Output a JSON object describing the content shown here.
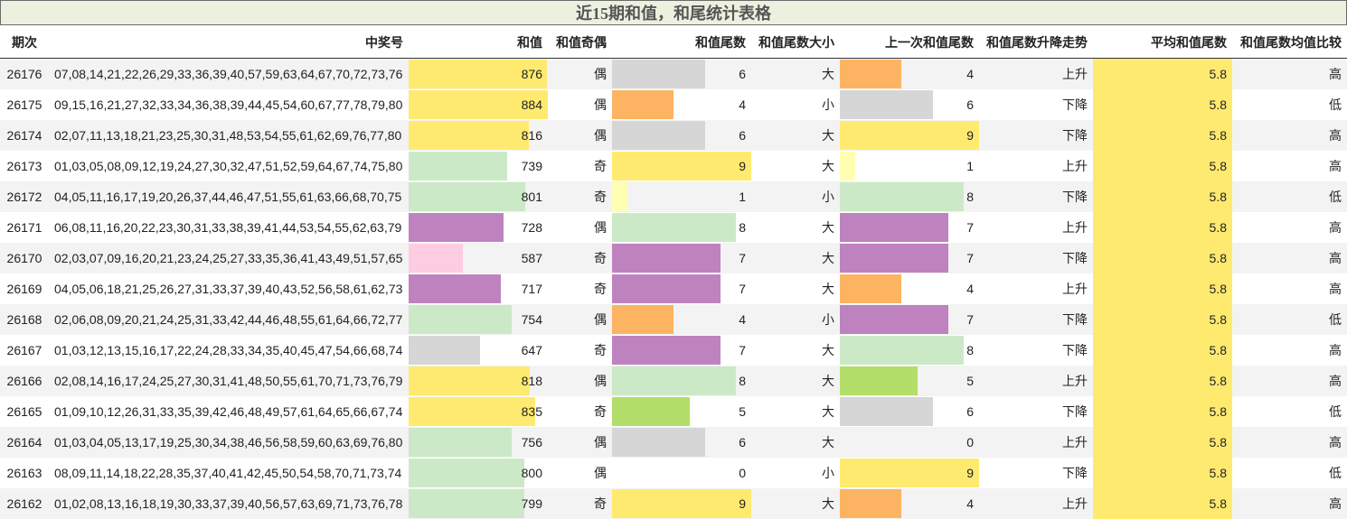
{
  "title": "近15期和值，和尾统计表格",
  "headers": [
    "期次",
    "中奖号",
    "和值",
    "和值奇偶",
    "和值尾数",
    "和值尾数大小",
    "上一次和值尾数",
    "和值尾数升降走势",
    "平均和值尾数",
    "和值尾数均值比较"
  ],
  "colors": {
    "yellow": "#ffea70",
    "green": "#cce9c7",
    "purple": "#be83bf",
    "pink": "#fdcce3",
    "gray": "#d6d6d6",
    "orange": "#fdb462",
    "lightyellow": "#ffffb3",
    "lime": "#b3de69"
  },
  "rows": [
    {
      "issue": "26176",
      "numbers": "07,08,14,21,22,26,29,33,36,39,40,57,59,63,64,67,70,72,73,76",
      "sum": "876",
      "parity": "偶",
      "tail": "6",
      "size": "大",
      "prev_tail": "4",
      "trend": "上升",
      "avg": "5.8",
      "compare": "高",
      "sum_color": "yellow",
      "tail_color": "gray",
      "prev_color": "orange"
    },
    {
      "issue": "26175",
      "numbers": "09,15,16,21,27,32,33,34,36,38,39,44,45,54,60,67,77,78,79,80",
      "sum": "884",
      "parity": "偶",
      "tail": "4",
      "size": "小",
      "prev_tail": "6",
      "trend": "下降",
      "avg": "5.8",
      "compare": "低",
      "sum_color": "yellow",
      "tail_color": "orange",
      "prev_color": "gray"
    },
    {
      "issue": "26174",
      "numbers": "02,07,11,13,18,21,23,25,30,31,48,53,54,55,61,62,69,76,77,80",
      "sum": "816",
      "parity": "偶",
      "tail": "6",
      "size": "大",
      "prev_tail": "9",
      "trend": "下降",
      "avg": "5.8",
      "compare": "高",
      "sum_color": "yellow",
      "tail_color": "gray",
      "prev_color": "yellow"
    },
    {
      "issue": "26173",
      "numbers": "01,03,05,08,09,12,19,24,27,30,32,47,51,52,59,64,67,74,75,80",
      "sum": "739",
      "parity": "奇",
      "tail": "9",
      "size": "大",
      "prev_tail": "1",
      "trend": "上升",
      "avg": "5.8",
      "compare": "高",
      "sum_color": "green",
      "tail_color": "yellow",
      "prev_color": "lightyellow"
    },
    {
      "issue": "26172",
      "numbers": "04,05,11,16,17,19,20,26,37,44,46,47,51,55,61,63,66,68,70,75",
      "sum": "801",
      "parity": "奇",
      "tail": "1",
      "size": "小",
      "prev_tail": "8",
      "trend": "下降",
      "avg": "5.8",
      "compare": "低",
      "sum_color": "green",
      "tail_color": "lightyellow",
      "prev_color": "green"
    },
    {
      "issue": "26171",
      "numbers": "06,08,11,16,20,22,23,30,31,33,38,39,41,44,53,54,55,62,63,79",
      "sum": "728",
      "parity": "偶",
      "tail": "8",
      "size": "大",
      "prev_tail": "7",
      "trend": "上升",
      "avg": "5.8",
      "compare": "高",
      "sum_color": "purple",
      "tail_color": "green",
      "prev_color": "purple"
    },
    {
      "issue": "26170",
      "numbers": "02,03,07,09,16,20,21,23,24,25,27,33,35,36,41,43,49,51,57,65",
      "sum": "587",
      "parity": "奇",
      "tail": "7",
      "size": "大",
      "prev_tail": "7",
      "trend": "下降",
      "avg": "5.8",
      "compare": "高",
      "sum_color": "pink",
      "tail_color": "purple",
      "prev_color": "purple"
    },
    {
      "issue": "26169",
      "numbers": "04,05,06,18,21,25,26,27,31,33,37,39,40,43,52,56,58,61,62,73",
      "sum": "717",
      "parity": "奇",
      "tail": "7",
      "size": "大",
      "prev_tail": "4",
      "trend": "上升",
      "avg": "5.8",
      "compare": "高",
      "sum_color": "purple",
      "tail_color": "purple",
      "prev_color": "orange"
    },
    {
      "issue": "26168",
      "numbers": "02,06,08,09,20,21,24,25,31,33,42,44,46,48,55,61,64,66,72,77",
      "sum": "754",
      "parity": "偶",
      "tail": "4",
      "size": "小",
      "prev_tail": "7",
      "trend": "下降",
      "avg": "5.8",
      "compare": "低",
      "sum_color": "green",
      "tail_color": "orange",
      "prev_color": "purple"
    },
    {
      "issue": "26167",
      "numbers": "01,03,12,13,15,16,17,22,24,28,33,34,35,40,45,47,54,66,68,74",
      "sum": "647",
      "parity": "奇",
      "tail": "7",
      "size": "大",
      "prev_tail": "8",
      "trend": "下降",
      "avg": "5.8",
      "compare": "高",
      "sum_color": "gray",
      "tail_color": "purple",
      "prev_color": "green"
    },
    {
      "issue": "26166",
      "numbers": "02,08,14,16,17,24,25,27,30,31,41,48,50,55,61,70,71,73,76,79",
      "sum": "818",
      "parity": "偶",
      "tail": "8",
      "size": "大",
      "prev_tail": "5",
      "trend": "上升",
      "avg": "5.8",
      "compare": "高",
      "sum_color": "yellow",
      "tail_color": "green",
      "prev_color": "lime"
    },
    {
      "issue": "26165",
      "numbers": "01,09,10,12,26,31,33,35,39,42,46,48,49,57,61,64,65,66,67,74",
      "sum": "835",
      "parity": "奇",
      "tail": "5",
      "size": "大",
      "prev_tail": "6",
      "trend": "下降",
      "avg": "5.8",
      "compare": "低",
      "sum_color": "yellow",
      "tail_color": "lime",
      "prev_color": "gray"
    },
    {
      "issue": "26164",
      "numbers": "01,03,04,05,13,17,19,25,30,34,38,46,56,58,59,60,63,69,76,80",
      "sum": "756",
      "parity": "偶",
      "tail": "6",
      "size": "大",
      "prev_tail": "0",
      "trend": "上升",
      "avg": "5.8",
      "compare": "高",
      "sum_color": "green",
      "tail_color": "gray",
      "prev_color": "none"
    },
    {
      "issue": "26163",
      "numbers": "08,09,11,14,18,22,28,35,37,40,41,42,45,50,54,58,70,71,73,74",
      "sum": "800",
      "parity": "偶",
      "tail": "0",
      "size": "小",
      "prev_tail": "9",
      "trend": "下降",
      "avg": "5.8",
      "compare": "低",
      "sum_color": "green",
      "tail_color": "none",
      "prev_color": "yellow"
    },
    {
      "issue": "26162",
      "numbers": "01,02,08,13,16,18,19,30,33,37,39,40,56,57,63,69,71,73,76,78",
      "sum": "799",
      "parity": "奇",
      "tail": "9",
      "size": "大",
      "prev_tail": "4",
      "trend": "上升",
      "avg": "5.8",
      "compare": "高",
      "sum_color": "green",
      "tail_color": "yellow",
      "prev_color": "orange"
    }
  ]
}
